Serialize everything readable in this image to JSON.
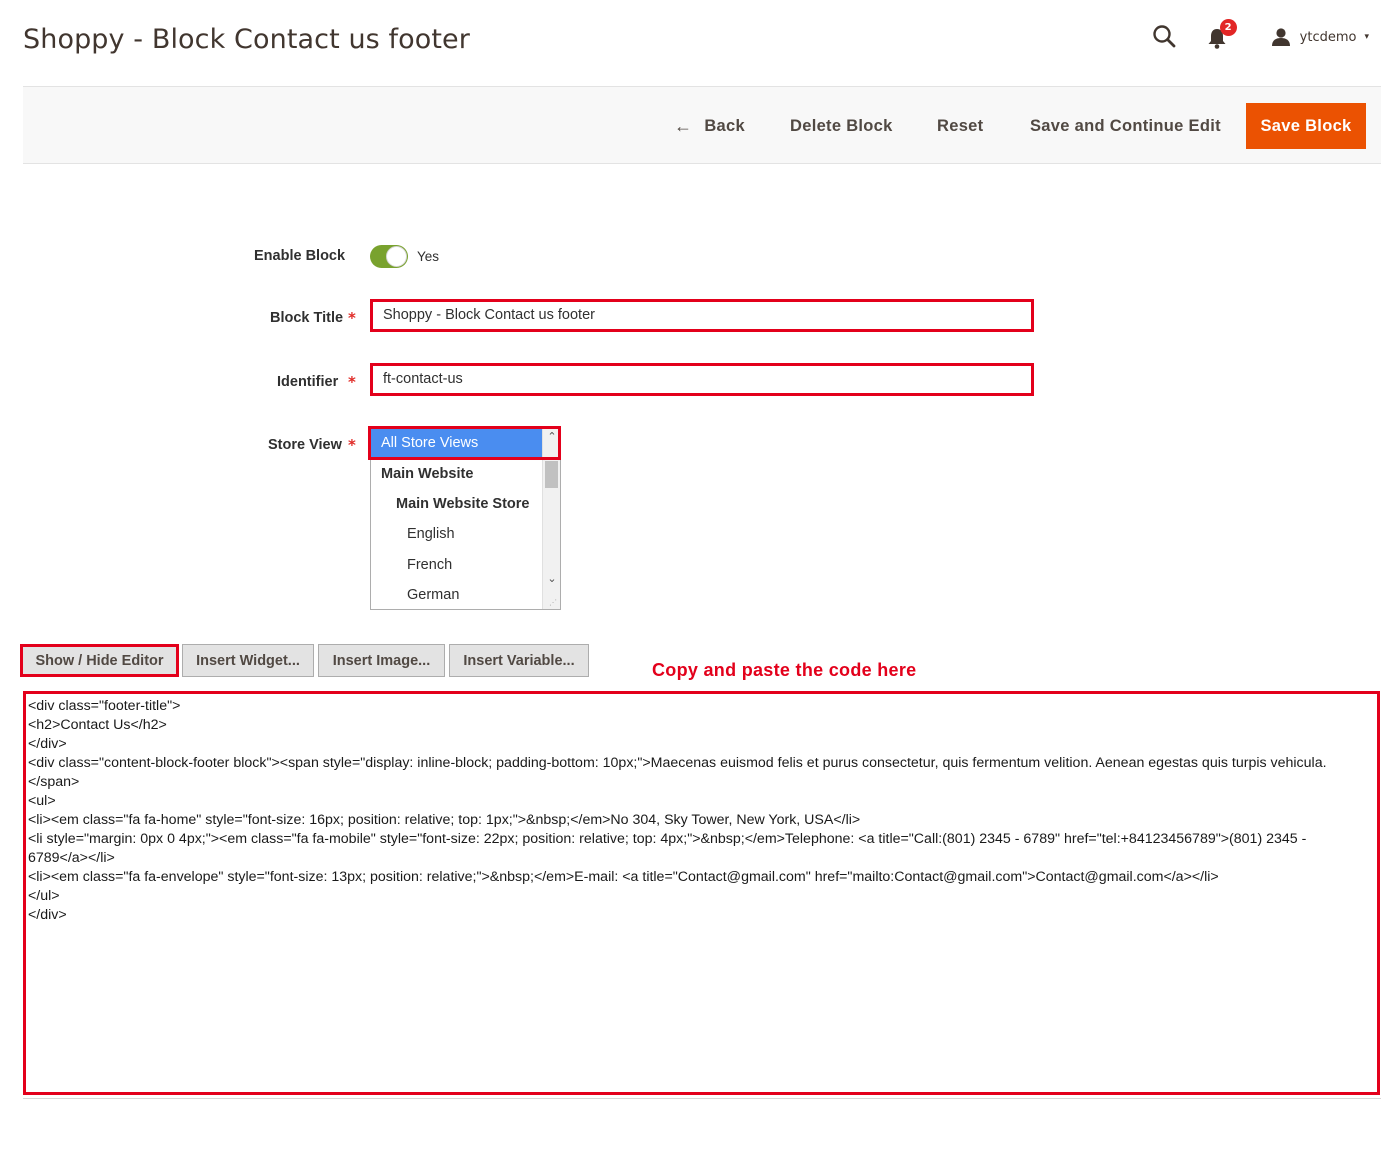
{
  "page": {
    "title": "Shoppy - Block Contact us footer"
  },
  "header": {
    "search_icon": "search-icon",
    "notifications_icon": "bell-icon",
    "notification_count": "2",
    "user_icon": "user-icon",
    "username": "ytcdemo",
    "user_caret": "▾"
  },
  "toolbar": {
    "back_label": "Back",
    "back_icon": "←",
    "delete_label": "Delete Block",
    "reset_label": "Reset",
    "save_continue_label": "Save and Continue Edit",
    "save_label": "Save Block",
    "save_color": "#eb5202"
  },
  "form": {
    "enable_label": "Enable Block",
    "enable_value": "Yes",
    "enable_state": true,
    "title_label": "Block Title",
    "title_value": "Shoppy  - Block Contact us footer",
    "identifier_label": "Identifier",
    "identifier_value": "ft-contact-us",
    "store_view_label": "Store View",
    "required_mark": "*",
    "store_options": {
      "selected": "All Store Views",
      "website": "Main Website",
      "store": "Main Website Store",
      "view_1": "English",
      "view_2": "French",
      "view_3": "German"
    }
  },
  "editor": {
    "show_hide_label": "Show / Hide Editor",
    "insert_widget_label": "Insert Widget...",
    "insert_image_label": "Insert Image...",
    "insert_variable_label": "Insert Variable...",
    "annotation": "Copy and paste the code here",
    "content": "<div class=\"footer-title\">\n<h2>Contact Us</h2>\n</div>\n<div class=\"content-block-footer block\"><span style=\"display: inline-block; padding-bottom: 10px;\">Maecenas euismod felis et purus consectetur, quis fermentum velition. Aenean egestas quis turpis vehicula.\n</span>\n<ul>\n<li><em class=\"fa fa-home\" style=\"font-size: 16px; position: relative; top: 1px;\">&nbsp;</em>No 304, Sky Tower, New York, USA</li>\n<li style=\"margin: 0px 0 4px;\"><em class=\"fa fa-mobile\" style=\"font-size: 22px; position: relative; top: 4px;\">&nbsp;</em>Telephone: <a title=\"Call:(801) 2345 - 6789\" href=\"tel:+84123456789\">(801) 2345 -\n6789</a></li>\n<li><em class=\"fa fa-envelope\" style=\"font-size: 13px; position: relative;\">&nbsp;</em>E-mail: <a title=\"Contact@gmail.com\" href=\"mailto:Contact@gmail.com\">Contact@gmail.com</a></li>\n</ul>\n</div>"
  }
}
